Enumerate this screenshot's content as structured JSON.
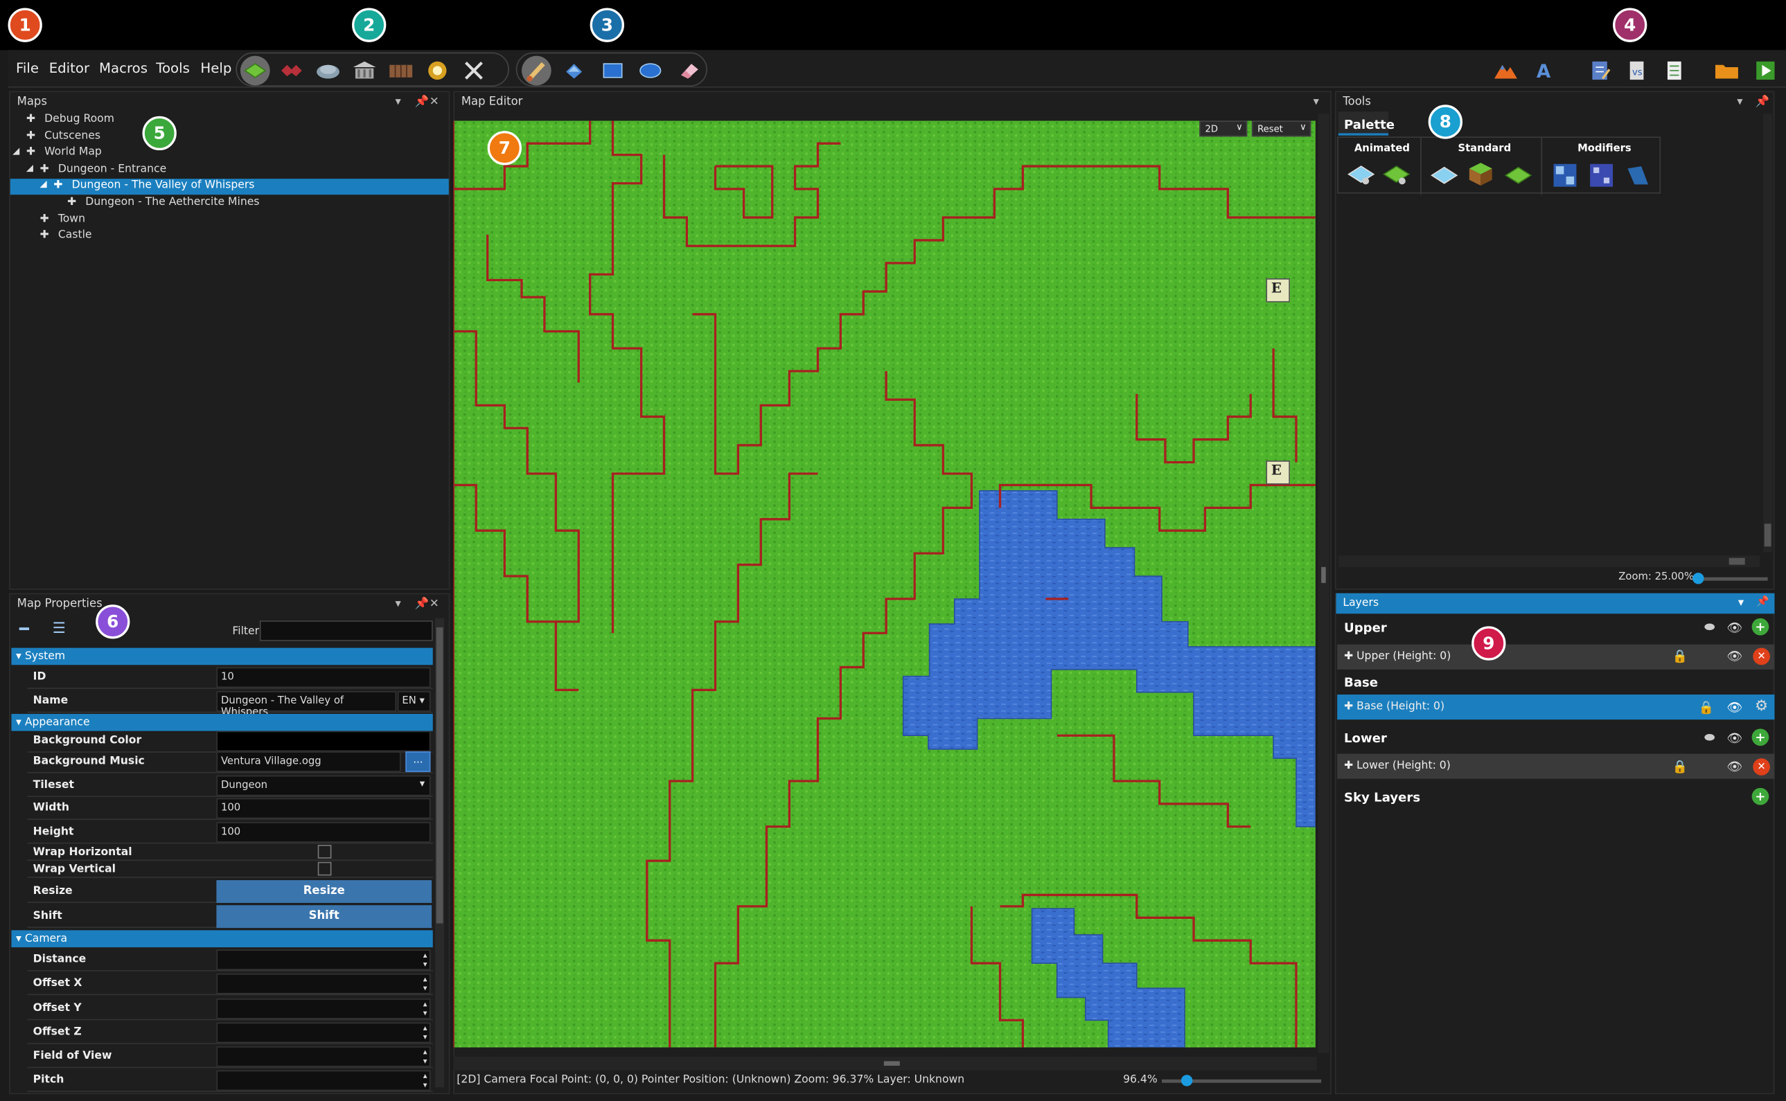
{
  "badges": [
    "1",
    "2",
    "3",
    "4",
    "5",
    "6",
    "7",
    "8",
    "9"
  ],
  "menu": [
    "File",
    "Editor",
    "Macros",
    "Tools",
    "Help"
  ],
  "maps_panel": {
    "title": "Maps",
    "items": [
      {
        "label": "Debug Room",
        "depth": 0
      },
      {
        "label": "Cutscenes",
        "depth": 0
      },
      {
        "label": "World Map",
        "depth": 0
      },
      {
        "label": "Dungeon - Entrance",
        "depth": 1
      },
      {
        "label": "Dungeon - The Valley of Whispers",
        "depth": 2,
        "selected": true
      },
      {
        "label": "Dungeon - The Aethercite Mines",
        "depth": 3
      },
      {
        "label": "Town",
        "depth": 0
      },
      {
        "label": "Castle",
        "depth": 0
      }
    ]
  },
  "props_panel": {
    "title": "Map Properties",
    "filter_label": "Filter",
    "cat_system": "System",
    "cat_appearance": "Appearance",
    "cat_camera": "Camera",
    "id_label": "ID",
    "id_value": "10",
    "name_label": "Name",
    "name_value": "Dungeon - The Valley of Whispers",
    "lang": "EN",
    "bgcolor_label": "Background Color",
    "bgmusic_label": "Background Music",
    "bgmusic_value": "Ventura Village.ogg",
    "browse": "...",
    "tileset_label": "Tileset",
    "tileset_value": "Dungeon",
    "width_label": "Width",
    "width_value": "100",
    "height_label": "Height",
    "height_value": "100",
    "wraph_label": "Wrap Horizontal",
    "wrapv_label": "Wrap Vertical",
    "resize_label": "Resize",
    "resize_btn": "Resize",
    "shift_label": "Shift",
    "shift_btn": "Shift",
    "distance_label": "Distance",
    "offx_label": "Offset X",
    "offy_label": "Offset Y",
    "offz_label": "Offset Z",
    "fov_label": "Field of View",
    "pitch_label": "Pitch"
  },
  "editor": {
    "title": "Map Editor",
    "mode": "2D",
    "reset": "Reset",
    "status": "[2D] Camera Focal Point: (0, 0, 0) Pointer Position: (Unknown) Zoom: 96.37% Layer: Unknown",
    "zoom": "96.4%",
    "zoom_fraction": 0.12,
    "event_glyph": "E"
  },
  "tools_panel": {
    "title": "Tools",
    "tab": "Palette",
    "group_animated": "Animated",
    "group_standard": "Standard",
    "group_modifiers": "Modifiers",
    "zoom": "Zoom: 25.00%"
  },
  "layers_panel": {
    "title": "Layers",
    "upper": "Upper",
    "upper_row": "Upper (Height: 0)",
    "base": "Base",
    "base_row": "Base (Height: 0)",
    "lower": "Lower",
    "lower_row": "Lower (Height: 0)",
    "sky": "Sky Layers"
  },
  "colors": {
    "accent": "#1b7fbf",
    "grass": "#4caf28",
    "water": "#3a6fcf",
    "wall": "#9b2a2a"
  }
}
